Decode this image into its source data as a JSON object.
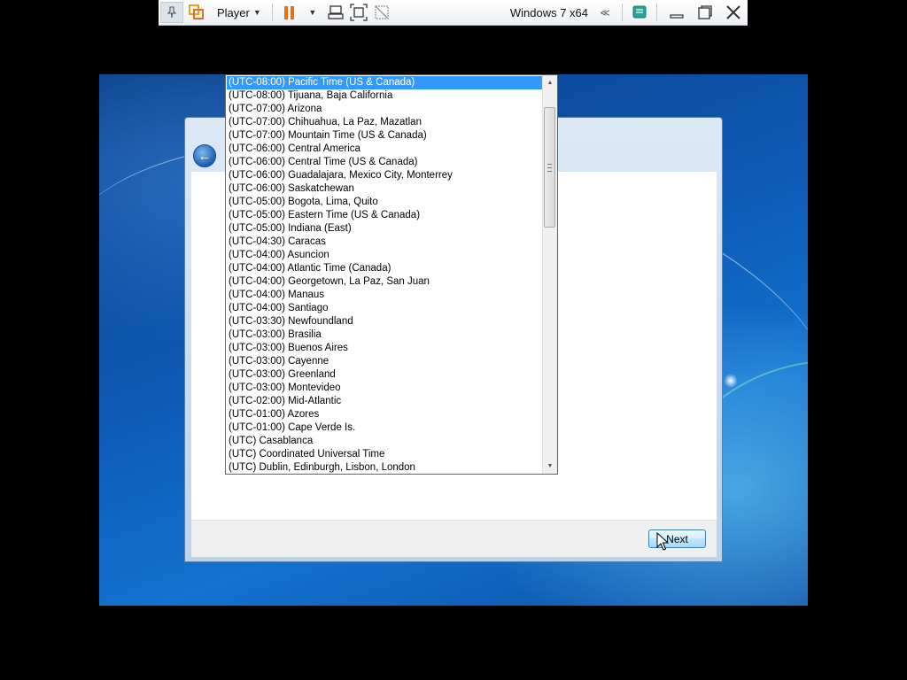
{
  "player_toolbar": {
    "menu_label": "Player",
    "vm_name": "Windows 7 x64",
    "expand_glyph": "≪",
    "icons": [
      "pin-icon",
      "vmware-logo-icon",
      "pause-icon",
      "send-ctrl-alt-del-icon",
      "fit-guest-icon",
      "unity-icon",
      "message-icon",
      "minimize-icon",
      "restore-icon",
      "close-icon"
    ],
    "accent_color": "#e07020"
  },
  "dialog": {
    "back_icon": "back-arrow-icon",
    "next_label": "Next"
  },
  "timezone_list": {
    "selected_index": 0,
    "items": [
      "(UTC-08:00) Pacific Time (US & Canada)",
      "(UTC-08:00) Tijuana, Baja California",
      "(UTC-07:00) Arizona",
      "(UTC-07:00) Chihuahua, La Paz, Mazatlan",
      "(UTC-07:00) Mountain Time (US & Canada)",
      "(UTC-06:00) Central America",
      "(UTC-06:00) Central Time (US & Canada)",
      "(UTC-06:00) Guadalajara, Mexico City, Monterrey",
      "(UTC-06:00) Saskatchewan",
      "(UTC-05:00) Bogota, Lima, Quito",
      "(UTC-05:00) Eastern Time (US & Canada)",
      "(UTC-05:00) Indiana (East)",
      "(UTC-04:30) Caracas",
      "(UTC-04:00) Asuncion",
      "(UTC-04:00) Atlantic Time (Canada)",
      "(UTC-04:00) Georgetown, La Paz, San Juan",
      "(UTC-04:00) Manaus",
      "(UTC-04:00) Santiago",
      "(UTC-03:30) Newfoundland",
      "(UTC-03:00) Brasilia",
      "(UTC-03:00) Buenos Aires",
      "(UTC-03:00) Cayenne",
      "(UTC-03:00) Greenland",
      "(UTC-03:00) Montevideo",
      "(UTC-02:00) Mid-Atlantic",
      "(UTC-01:00) Azores",
      "(UTC-01:00) Cape Verde Is.",
      "(UTC) Casablanca",
      "(UTC) Coordinated Universal Time",
      "(UTC) Dublin, Edinburgh, Lisbon, London"
    ],
    "selection_color": "#3399ff"
  }
}
